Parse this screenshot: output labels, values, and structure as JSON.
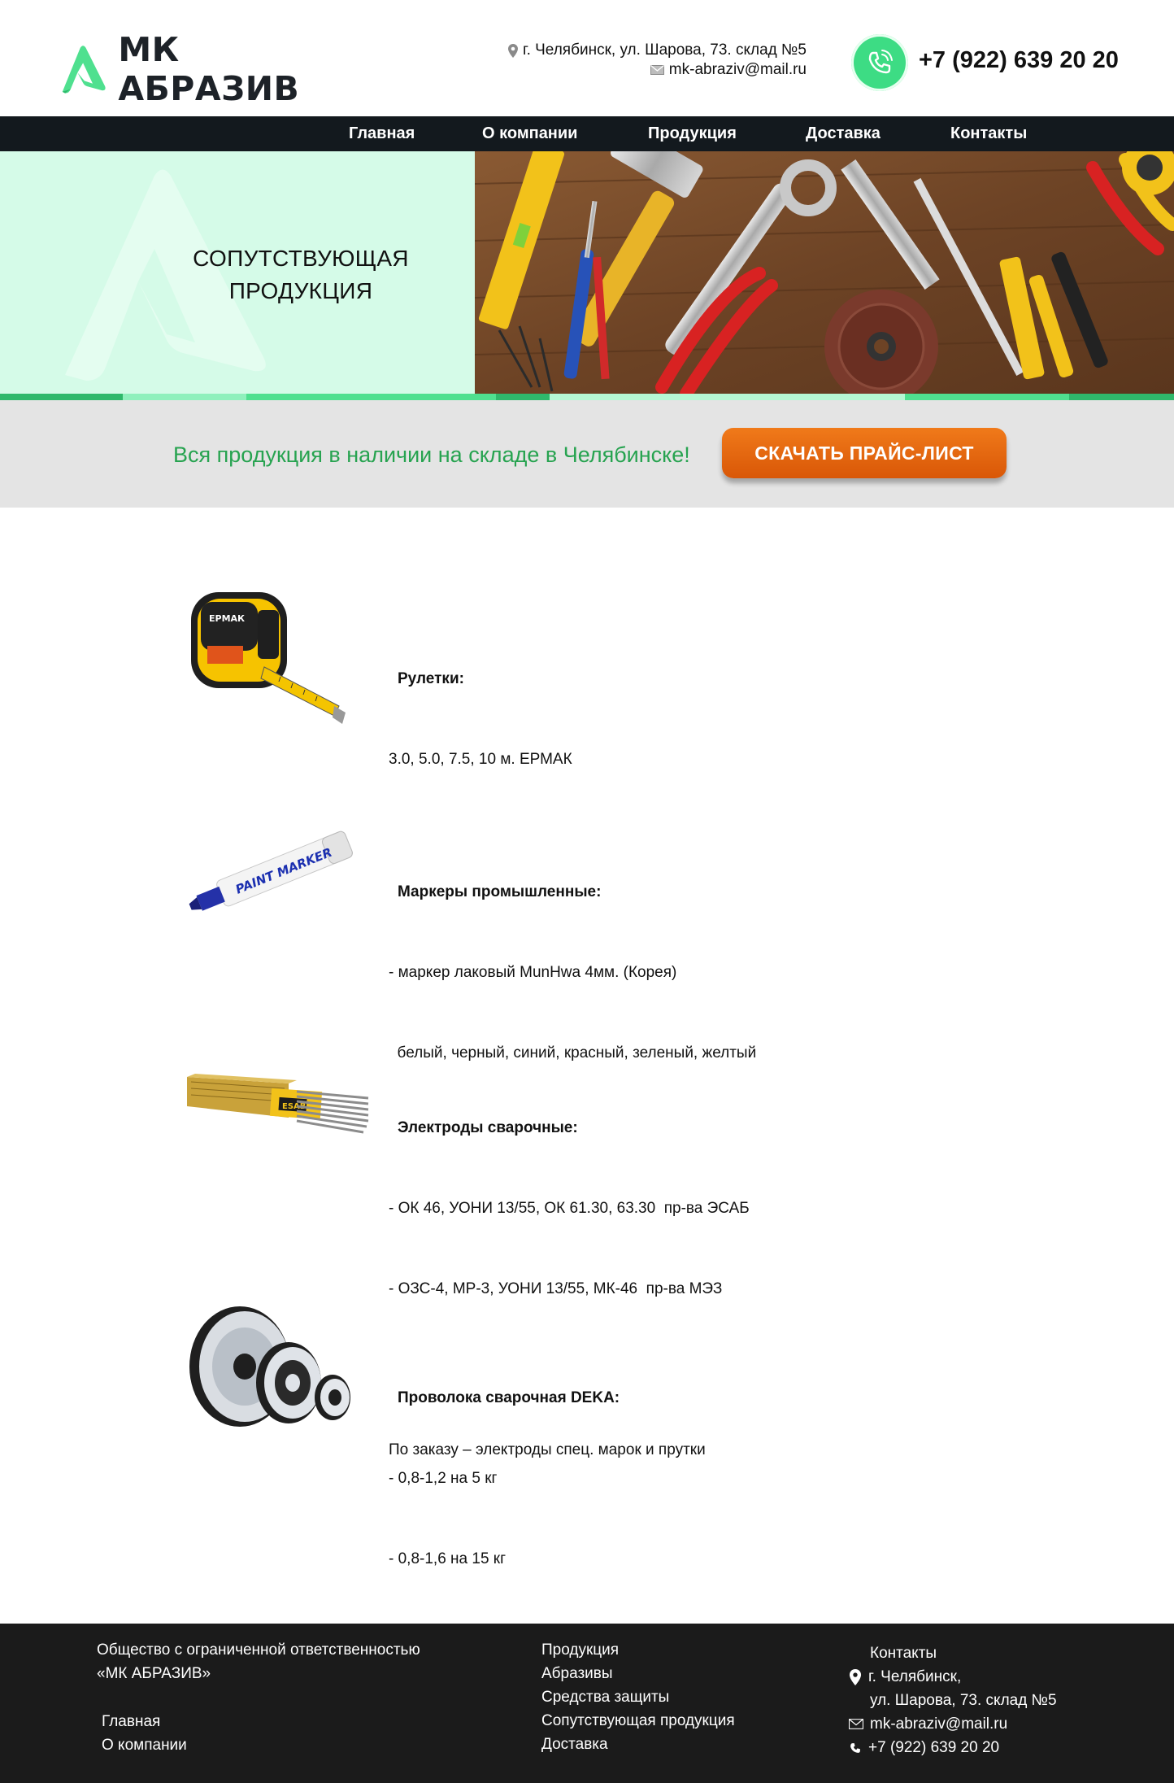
{
  "header": {
    "logo_text": "МК АБРАЗИВ",
    "address": "г. Челябинск, ул. Шарова, 73. склад №5",
    "email": "mk-abraziv@mail.ru",
    "phone": "+7 (922) 639 20 20"
  },
  "nav": {
    "items": [
      {
        "label": "Главная"
      },
      {
        "label": "О компании"
      },
      {
        "label": "Продукция"
      },
      {
        "label": "Доставка"
      },
      {
        "label": "Контакты"
      }
    ]
  },
  "hero": {
    "title_line1": "СОПУТСТВУЮЩАЯ",
    "title_line2": "ПРОДУКЦИЯ"
  },
  "banner": {
    "text": "Вся продукция в наличии на складе в Челябинске!",
    "button_label": "СКАЧАТЬ ПРАЙС-ЛИСТ"
  },
  "products": [
    {
      "title": "Рулетки:",
      "lines": [
        "3.0, 5.0, 7.5, 10 м. ЕРМАК"
      ],
      "image_icon": "tape-measure-icon"
    },
    {
      "title": "Маркеры промышленные:",
      "lines": [
        "- маркер лаковый MunHwa 4мм. (Корея)",
        "  белый, черный, синий, красный, зеленый, желтый"
      ],
      "image_icon": "paint-marker-icon",
      "marker_label": "PAINT MARKER"
    },
    {
      "title": "Электроды сварочные:",
      "lines": [
        "- ОК 46, УОНИ 13/55, ОК 61.30, 63.30  пр-ва ЭСАБ",
        "- ОЗС-4, МР-3, УОНИ 13/55, МК-46  пр-ва МЭЗ",
        "",
        "По заказу – электроды спец. марок и прутки"
      ],
      "image_icon": "welding-electrodes-icon",
      "pack_label": "ESAB"
    },
    {
      "title": "Проволока сварочная DEKA:",
      "lines": [
        "- 0,8-1,2 на 5 кг",
        "- 0,8-1,6 на 15 кг"
      ],
      "image_icon": "wire-spool-icon"
    }
  ],
  "footer": {
    "company_line1": "Общество с ограниченной ответственностью",
    "company_line2": "«МК АБРАЗИВ»",
    "links_left": [
      "Главная",
      "О компании"
    ],
    "links_middle": [
      "Продукция",
      "Абразивы",
      "Средства защиты",
      "Сопутствующая продукция",
      "Доставка"
    ],
    "contacts_title": "Контакты",
    "address_line1": "г. Челябинск,",
    "address_line2": "ул. Шарова, 73. склад №5",
    "email": "mk-abraziv@mail.ru",
    "phone": "+7 (922) 639 20 20"
  },
  "colors": {
    "accent_green": "#3ddc84",
    "nav_bg": "#13191e",
    "hero_bg": "#d5fbe8",
    "banner_text": "#27a350",
    "button_orange": "#e8650f",
    "footer_bg": "#1b1b1b"
  }
}
